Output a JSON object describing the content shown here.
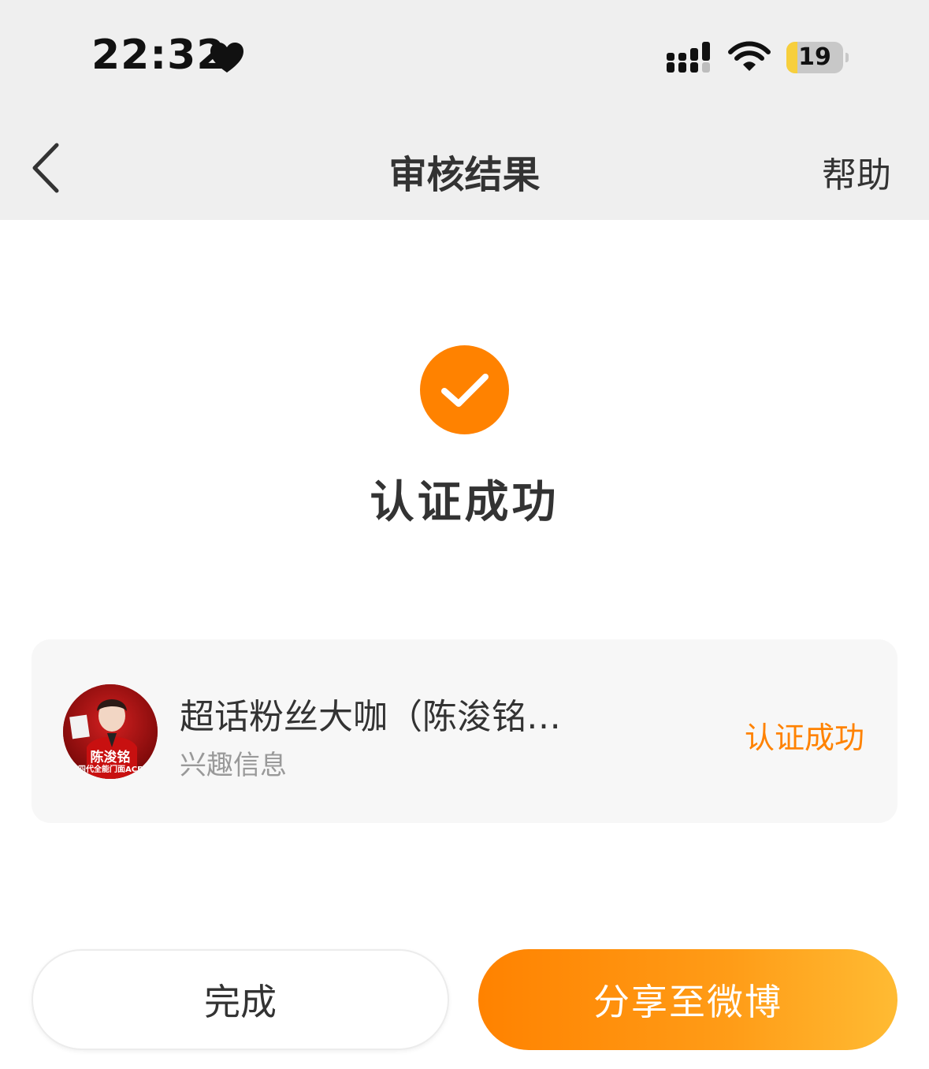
{
  "status_bar": {
    "time": "22:32",
    "battery_level": "19",
    "battery_fraction": 0.19,
    "icons": [
      "heart-icon",
      "cellular-signal-icon",
      "wifi-icon",
      "battery-icon"
    ]
  },
  "nav": {
    "back_icon": "chevron-left-icon",
    "title": "审核结果",
    "help_label": "帮助"
  },
  "result": {
    "icon": "check-circle-icon",
    "title": "认证成功"
  },
  "card": {
    "avatar_text_line1": "陈浚铭",
    "avatar_text_line2": "四代全能门面ACE",
    "title": "超话粉丝大咖（陈浚铭…",
    "subtitle": "兴趣信息",
    "status": "认证成功"
  },
  "buttons": {
    "done_label": "完成",
    "share_label": "分享至微博"
  },
  "colors": {
    "accent": "#ff8200",
    "nav_background": "#efefef",
    "card_background": "#f7f7f7"
  }
}
